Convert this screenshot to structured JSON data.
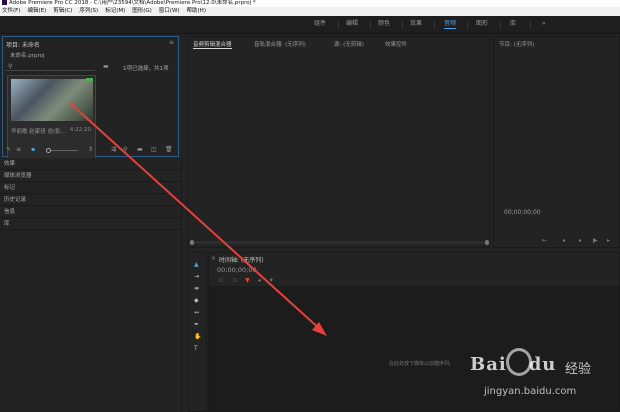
{
  "window": {
    "title": "Adobe Premiere Pro CC 2018 - C:\\用户\\23594\\文档\\Adobe\\Premiere Pro\\12.0\\未命名.prproj *"
  },
  "menubar": [
    "文件(F)",
    "编辑(E)",
    "剪辑(C)",
    "序列(S)",
    "标记(M)",
    "图形(G)",
    "窗口(W)",
    "帮助(H)"
  ],
  "workspaces": {
    "tabs": [
      {
        "label": "组件"
      },
      {
        "label": "编辑"
      },
      {
        "label": "颜色"
      },
      {
        "label": "效果"
      },
      {
        "label": "音频"
      },
      {
        "label": "图形"
      },
      {
        "label": "库"
      }
    ],
    "active": "音频",
    "more": "»"
  },
  "project": {
    "title": "项目: 未命名",
    "file": "未命名.prproj",
    "selection": "1项已选择，共1项",
    "clip": {
      "name": "华丽歌 赵家班 逆(影...",
      "duration": "4:22:20"
    },
    "tools_labels": [
      "⚲",
      "≡",
      "▣",
      "◦"
    ]
  },
  "panels_list": [
    {
      "label": "效果"
    },
    {
      "label": "媒体浏览器"
    },
    {
      "label": "标记"
    },
    {
      "label": "历史记录"
    },
    {
      "label": "信息"
    },
    {
      "label": "库"
    }
  ],
  "source": {
    "tabs": [
      {
        "label": "音频剪辑混合器"
      },
      {
        "label": "音轨混合器: (无序列)"
      },
      {
        "label": "源: (无剪辑)"
      },
      {
        "label": "效果控件"
      }
    ],
    "active": "音频剪辑混合器"
  },
  "program": {
    "title": "节目: (无序列)",
    "timecode": "00;00;00;00"
  },
  "timeline": {
    "title": "时间轴: (无序列)",
    "timecode": "00;00;00;00",
    "empty_hint": "在此处放下媒体以创建序列。"
  },
  "watermark": {
    "brand": "Bai",
    "brand2": "du",
    "jingyan": "经验",
    "url": "jingyan.baidu.com"
  },
  "colors": {
    "accent": "#4aa3df",
    "panel": "#232323",
    "annotation": "#e8403a"
  }
}
